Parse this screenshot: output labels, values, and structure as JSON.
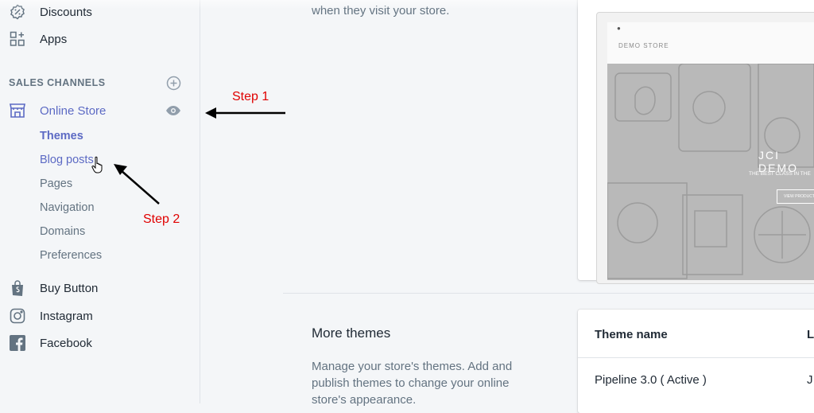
{
  "sidebar": {
    "top_items": [
      {
        "label": "Discounts",
        "icon": "discount-icon"
      },
      {
        "label": "Apps",
        "icon": "apps-icon"
      }
    ],
    "section_title": "SALES CHANNELS",
    "online_store": {
      "label": "Online Store",
      "icon": "store-icon"
    },
    "subitems": [
      "Themes",
      "Blog posts",
      "Pages",
      "Navigation",
      "Domains",
      "Preferences"
    ],
    "channels": [
      {
        "label": "Buy Button",
        "icon": "shopify-bag-icon"
      },
      {
        "label": "Instagram",
        "icon": "instagram-icon"
      },
      {
        "label": "Facebook",
        "icon": "facebook-icon"
      }
    ]
  },
  "annotations": {
    "step1": "Step 1",
    "step2": "Step 2"
  },
  "main": {
    "intro_text": "when they visit your store.",
    "preview": {
      "store_name": "DEMO STORE",
      "hero_title": "JCI DEMO",
      "hero_subtitle": "THE BEST CLASS IN THE",
      "button": "VIEW PRODUCTS"
    },
    "more_themes": {
      "title": "More themes",
      "description": "Manage your store's themes. Add and publish themes to change your online store's appearance."
    },
    "table": {
      "header": "Theme name",
      "header2": "L",
      "row_name": "Pipeline 3.0 ( Active )",
      "row2": "J"
    }
  },
  "colors": {
    "accent": "#5c6ac4",
    "annotation": "#e00000",
    "text": "#212b36",
    "muted": "#637381"
  }
}
